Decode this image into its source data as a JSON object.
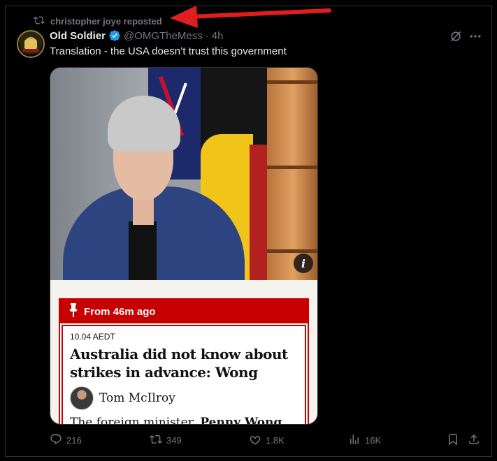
{
  "repost": {
    "label": "christopher joye reposted"
  },
  "author": {
    "display_name": "Old Soldier",
    "handle": "@OMGTheMess",
    "separator": "·",
    "time": "4h"
  },
  "tweet": {
    "text": "Translation - the USA doesn’t trust this government"
  },
  "media_card": {
    "photo_info_label": "i",
    "banner": "From 46m ago",
    "timestamp": "10.04 AEDT",
    "headline": "Australia did not know about strikes in advance: Wong",
    "author_name": "Tom McIlroy",
    "body_start": "The foreign minister,",
    "body_bold": "Penny Wong"
  },
  "actions": {
    "replies": "216",
    "reposts": "349",
    "likes": "1.8K",
    "views": "16K"
  },
  "colors": {
    "background": "#000000",
    "text": "#e7e9ea",
    "muted": "#71767b",
    "verified": "#1d9bf0",
    "annotation_arrow": "#e01e1e",
    "card_accent": "#c70000"
  },
  "icons": [
    "repost-icon",
    "verified-badge-icon",
    "grok-icon",
    "more-icon",
    "info-icon",
    "pin-icon",
    "reply-icon",
    "like-icon",
    "views-icon",
    "bookmark-icon",
    "share-icon"
  ]
}
